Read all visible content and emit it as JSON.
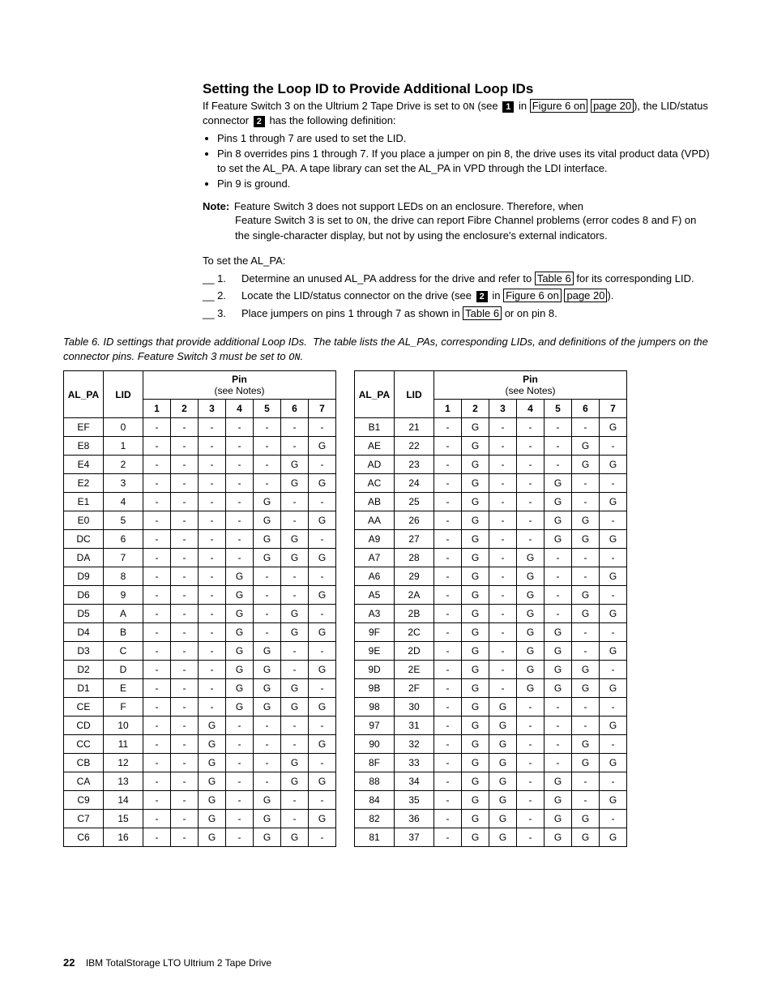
{
  "heading": "Setting the Loop ID to Provide Additional Loop IDs",
  "intro1a": "If Feature Switch 3 on the Ultrium 2 Tape Drive is set to ",
  "intro1_on": "ON",
  "intro1b": " (see ",
  "callout1": "1",
  "intro1c": " in ",
  "linkFig6a": "Figure 6 on",
  "linkFig6b": "page 20",
  "intro1d": "), the LID/status connector ",
  "callout2": "2",
  "intro1e": " has the following definition:",
  "bullets": [
    "Pins 1 through 7 are used to set the LID.",
    "Pin 8 overrides pins 1 through 7. If you place a jumper on pin 8, the drive uses its vital product data (VPD) to set the AL_PA. A tape library can set the AL_PA in VPD through the LDI interface.",
    "Pin 9 is ground."
  ],
  "noteLabel": "Note:",
  "noteBody": "Feature Switch 3 does not support LEDs on an enclosure. Therefore, when Feature Switch 3 is set to ON, the drive can report Fibre Channel problems (error codes 8 and F) on the single-character display, but not by using the enclosure's external indicators.",
  "toSet": "To set the AL_PA:",
  "steps": [
    {
      "n": "__ 1.",
      "a": "Determine an unused AL_PA address for the drive and refer to ",
      "link": "Table 6",
      "b": " for its corresponding LID."
    },
    {
      "n": "__ 2.",
      "a": "Locate the LID/status connector on the drive (see ",
      "callout": "2",
      "b": " in ",
      "link1": "Figure 6 on",
      "link2": "page 20",
      "c": ")."
    },
    {
      "n": "__ 3.",
      "a": "Place jumpers on pins 1 through 7 as shown in ",
      "link": "Table 6",
      "b": " or on pin 8."
    }
  ],
  "caption_a": "Table 6. ID settings that provide additional Loop IDs.",
  "caption_b": "The table lists the AL_PAs, corresponding LIDs, and definitions of the jumpers on the connector pins. Feature Switch 3 must be set to ",
  "caption_on": "ON",
  "caption_c": ".",
  "headers": {
    "alpa": "AL_PA",
    "lid": "LID",
    "pinTop": "Pin",
    "pinSub": "(see Notes)",
    "pins": [
      "1",
      "2",
      "3",
      "4",
      "5",
      "6",
      "7"
    ]
  },
  "left": [
    [
      "EF",
      "0",
      "-",
      "-",
      "-",
      "-",
      "-",
      "-",
      "-"
    ],
    [
      "E8",
      "1",
      "-",
      "-",
      "-",
      "-",
      "-",
      "-",
      "G"
    ],
    [
      "E4",
      "2",
      "-",
      "-",
      "-",
      "-",
      "-",
      "G",
      "-"
    ],
    [
      "E2",
      "3",
      "-",
      "-",
      "-",
      "-",
      "-",
      "G",
      "G"
    ],
    [
      "E1",
      "4",
      "-",
      "-",
      "-",
      "-",
      "G",
      "-",
      "-"
    ],
    [
      "E0",
      "5",
      "-",
      "-",
      "-",
      "-",
      "G",
      "-",
      "G"
    ],
    [
      "DC",
      "6",
      "-",
      "-",
      "-",
      "-",
      "G",
      "G",
      "-"
    ],
    [
      "DA",
      "7",
      "-",
      "-",
      "-",
      "-",
      "G",
      "G",
      "G"
    ],
    [
      "D9",
      "8",
      "-",
      "-",
      "-",
      "G",
      "-",
      "-",
      "-"
    ],
    [
      "D6",
      "9",
      "-",
      "-",
      "-",
      "G",
      "-",
      "-",
      "G"
    ],
    [
      "D5",
      "A",
      "-",
      "-",
      "-",
      "G",
      "-",
      "G",
      "-"
    ],
    [
      "D4",
      "B",
      "-",
      "-",
      "-",
      "G",
      "-",
      "G",
      "G"
    ],
    [
      "D3",
      "C",
      "-",
      "-",
      "-",
      "G",
      "G",
      "-",
      "-"
    ],
    [
      "D2",
      "D",
      "-",
      "-",
      "-",
      "G",
      "G",
      "-",
      "G"
    ],
    [
      "D1",
      "E",
      "-",
      "-",
      "-",
      "G",
      "G",
      "G",
      "-"
    ],
    [
      "CE",
      "F",
      "-",
      "-",
      "-",
      "G",
      "G",
      "G",
      "G"
    ],
    [
      "CD",
      "10",
      "-",
      "-",
      "G",
      "-",
      "-",
      "-",
      "-"
    ],
    [
      "CC",
      "11",
      "-",
      "-",
      "G",
      "-",
      "-",
      "-",
      "G"
    ],
    [
      "CB",
      "12",
      "-",
      "-",
      "G",
      "-",
      "-",
      "G",
      "-"
    ],
    [
      "CA",
      "13",
      "-",
      "-",
      "G",
      "-",
      "-",
      "G",
      "G"
    ],
    [
      "C9",
      "14",
      "-",
      "-",
      "G",
      "-",
      "G",
      "-",
      "-"
    ],
    [
      "C7",
      "15",
      "-",
      "-",
      "G",
      "-",
      "G",
      "-",
      "G"
    ],
    [
      "C6",
      "16",
      "-",
      "-",
      "G",
      "-",
      "G",
      "G",
      "-"
    ]
  ],
  "right": [
    [
      "B1",
      "21",
      "-",
      "G",
      "-",
      "-",
      "-",
      "-",
      "G"
    ],
    [
      "AE",
      "22",
      "-",
      "G",
      "-",
      "-",
      "-",
      "G",
      "-"
    ],
    [
      "AD",
      "23",
      "-",
      "G",
      "-",
      "-",
      "-",
      "G",
      "G"
    ],
    [
      "AC",
      "24",
      "-",
      "G",
      "-",
      "-",
      "G",
      "-",
      "-"
    ],
    [
      "AB",
      "25",
      "-",
      "G",
      "-",
      "-",
      "G",
      "-",
      "G"
    ],
    [
      "AA",
      "26",
      "-",
      "G",
      "-",
      "-",
      "G",
      "G",
      "-"
    ],
    [
      "A9",
      "27",
      "-",
      "G",
      "-",
      "-",
      "G",
      "G",
      "G"
    ],
    [
      "A7",
      "28",
      "-",
      "G",
      "-",
      "G",
      "-",
      "-",
      "-"
    ],
    [
      "A6",
      "29",
      "-",
      "G",
      "-",
      "G",
      "-",
      "-",
      "G"
    ],
    [
      "A5",
      "2A",
      "-",
      "G",
      "-",
      "G",
      "-",
      "G",
      "-"
    ],
    [
      "A3",
      "2B",
      "-",
      "G",
      "-",
      "G",
      "-",
      "G",
      "G"
    ],
    [
      "9F",
      "2C",
      "-",
      "G",
      "-",
      "G",
      "G",
      "-",
      "-"
    ],
    [
      "9E",
      "2D",
      "-",
      "G",
      "-",
      "G",
      "G",
      "-",
      "G"
    ],
    [
      "9D",
      "2E",
      "-",
      "G",
      "-",
      "G",
      "G",
      "G",
      "-"
    ],
    [
      "9B",
      "2F",
      "-",
      "G",
      "-",
      "G",
      "G",
      "G",
      "G"
    ],
    [
      "98",
      "30",
      "-",
      "G",
      "G",
      "-",
      "-",
      "-",
      "-"
    ],
    [
      "97",
      "31",
      "-",
      "G",
      "G",
      "-",
      "-",
      "-",
      "G"
    ],
    [
      "90",
      "32",
      "-",
      "G",
      "G",
      "-",
      "-",
      "G",
      "-"
    ],
    [
      "8F",
      "33",
      "-",
      "G",
      "G",
      "-",
      "-",
      "G",
      "G"
    ],
    [
      "88",
      "34",
      "-",
      "G",
      "G",
      "-",
      "G",
      "-",
      "-"
    ],
    [
      "84",
      "35",
      "-",
      "G",
      "G",
      "-",
      "G",
      "-",
      "G"
    ],
    [
      "82",
      "36",
      "-",
      "G",
      "G",
      "-",
      "G",
      "G",
      "-"
    ],
    [
      "81",
      "37",
      "-",
      "G",
      "G",
      "-",
      "G",
      "G",
      "G"
    ]
  ],
  "footerPage": "22",
  "footerText": "IBM TotalStorage LTO Ultrium 2 Tape Drive"
}
